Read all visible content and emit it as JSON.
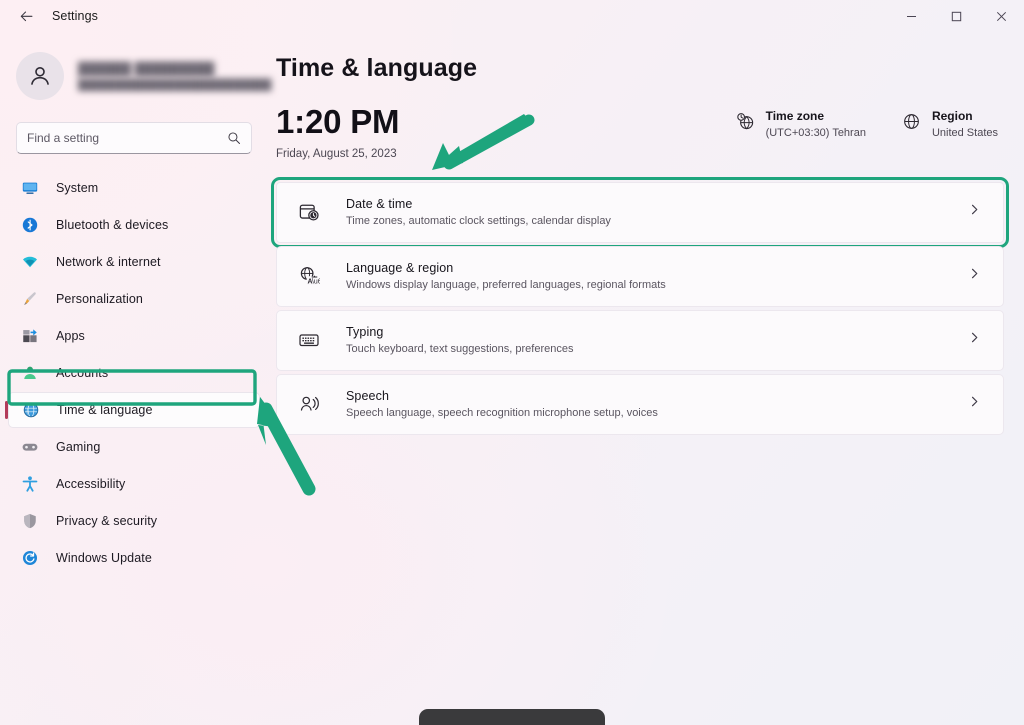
{
  "window": {
    "title": "Settings",
    "back_icon": "arrow-left-icon",
    "controls": {
      "minimize": "—",
      "maximize": "☐",
      "close": "✕"
    }
  },
  "account": {
    "name_redacted": "██████  █████████",
    "email_redacted": "██████████████████████████",
    "avatar_icon": "person-avatar-icon"
  },
  "search": {
    "placeholder": "Find a setting",
    "icon": "search-icon"
  },
  "sidebar": {
    "items": [
      {
        "label": "System",
        "icon": "monitor-icon",
        "selected": false
      },
      {
        "label": "Bluetooth & devices",
        "icon": "bluetooth-icon",
        "selected": false
      },
      {
        "label": "Network & internet",
        "icon": "wifi-icon",
        "selected": false
      },
      {
        "label": "Personalization",
        "icon": "paintbrush-icon",
        "selected": false
      },
      {
        "label": "Apps",
        "icon": "apps-grid-icon",
        "selected": false
      },
      {
        "label": "Accounts",
        "icon": "account-person-icon",
        "selected": false
      },
      {
        "label": "Time & language",
        "icon": "clock-globe-icon",
        "selected": true
      },
      {
        "label": "Gaming",
        "icon": "gamepad-icon",
        "selected": false
      },
      {
        "label": "Accessibility",
        "icon": "accessibility-icon",
        "selected": false
      },
      {
        "label": "Privacy & security",
        "icon": "shield-icon",
        "selected": false
      },
      {
        "label": "Windows Update",
        "icon": "update-refresh-icon",
        "selected": false
      }
    ]
  },
  "page": {
    "title": "Time & language",
    "clock": {
      "time": "1:20 PM",
      "date": "Friday, August 25, 2023"
    },
    "info": [
      {
        "label": "Time zone",
        "value": "(UTC+03:30) Tehran",
        "icon": "clock-globe-icon"
      },
      {
        "label": "Region",
        "value": "United States",
        "icon": "globe-icon"
      }
    ],
    "cards": [
      {
        "title": "Date & time",
        "subtitle": "Time zones, automatic clock settings, calendar display",
        "icon": "calendar-clock-icon",
        "chevron": "chevron-right-icon",
        "highlighted": true
      },
      {
        "title": "Language & region",
        "subtitle": "Windows display language, preferred languages, regional formats",
        "icon": "globe-language-icon",
        "chevron": "chevron-right-icon",
        "highlighted": false
      },
      {
        "title": "Typing",
        "subtitle": "Touch keyboard, text suggestions, preferences",
        "icon": "keyboard-icon",
        "chevron": "chevron-right-icon",
        "highlighted": false
      },
      {
        "title": "Speech",
        "subtitle": "Speech language, speech recognition microphone setup, voices",
        "icon": "speech-person-icon",
        "chevron": "chevron-right-icon",
        "highlighted": false
      }
    ]
  },
  "annotations": {
    "color": "#1ea57d",
    "arrows": [
      {
        "name": "arrow-to-date-and-time-card",
        "points_to": "Date & time"
      },
      {
        "name": "arrow-to-time-and-language-nav",
        "points_to": "Time & language"
      }
    ],
    "boxes": [
      {
        "name": "box-date-and-time-card",
        "target": "Date & time"
      },
      {
        "name": "box-time-and-language-nav",
        "target": "Time & language"
      }
    ]
  },
  "colors": {
    "annotation_green": "#1ea57d",
    "selection_accent": "#b33a5a",
    "background_start": "#fcf0f2",
    "background_end": "#f1f1f7"
  }
}
